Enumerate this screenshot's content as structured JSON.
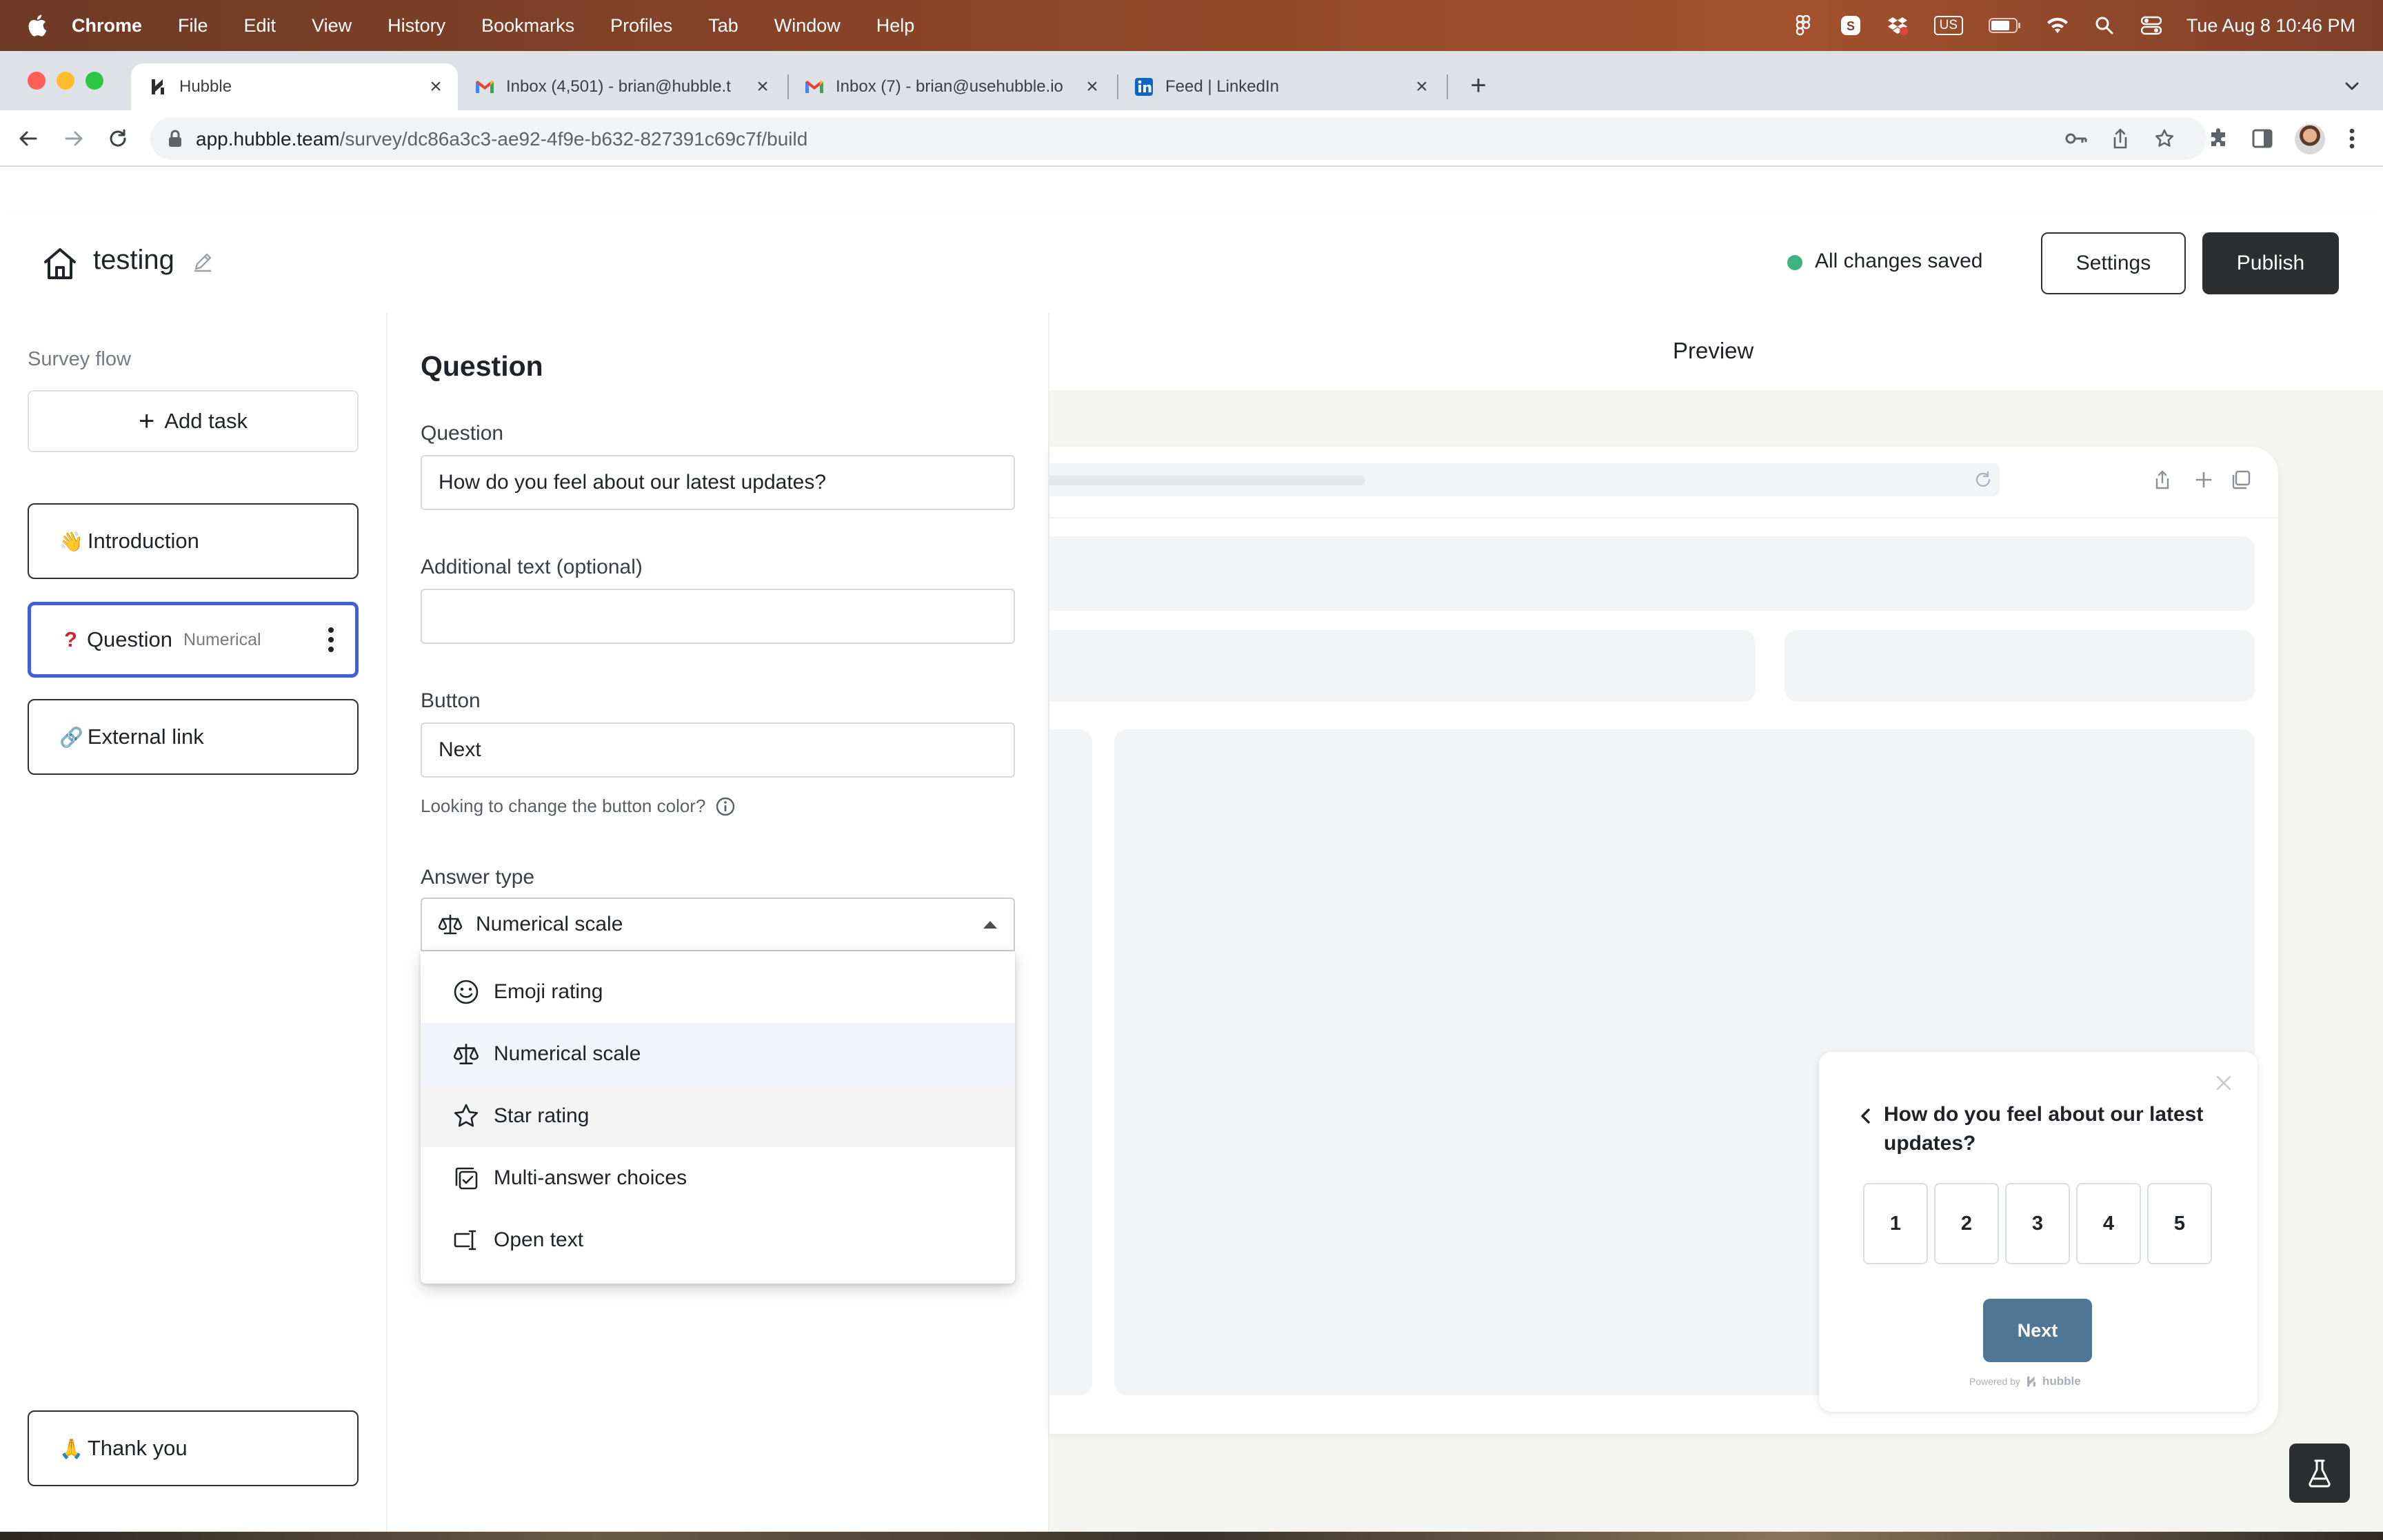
{
  "menubar": {
    "app_name": "Chrome",
    "items": [
      "File",
      "Edit",
      "View",
      "History",
      "Bookmarks",
      "Profiles",
      "Tab",
      "Window",
      "Help"
    ],
    "keyboard_label": "US",
    "clock": "Tue Aug 8  10:46 PM"
  },
  "browser": {
    "tabs": [
      {
        "title": "Hubble",
        "icon": "hubble-icon"
      },
      {
        "title": "Inbox (4,501) - brian@hubble.t",
        "icon": "gmail-icon"
      },
      {
        "title": "Inbox (7) - brian@usehubble.io",
        "icon": "gmail-icon"
      },
      {
        "title": "Feed | LinkedIn",
        "icon": "linkedin-icon"
      }
    ],
    "url_host": "app.hubble.team",
    "url_path": "/survey/dc86a3c3-ae92-4f9e-b632-827391c69c7f/build"
  },
  "header": {
    "survey_name": "testing",
    "save_status": "All changes saved",
    "settings_label": "Settings",
    "publish_label": "Publish",
    "status_color": "#3fb37f"
  },
  "sidebar": {
    "title": "Survey flow",
    "add_task_label": "Add task",
    "items": [
      {
        "emoji": "👋",
        "label": "Introduction"
      },
      {
        "emoji": "❓",
        "label": "Question",
        "sublabel": "Numerical"
      },
      {
        "emoji": "🔗",
        "label": "External link"
      }
    ],
    "thank_you": {
      "emoji": "🙏",
      "label": "Thank you"
    },
    "selected_border_color": "#3d5fdc"
  },
  "editor": {
    "title": "Question",
    "question_label": "Question",
    "question_value": "How do you feel about our latest updates?",
    "additional_label": "Additional text (optional)",
    "additional_value": "",
    "button_label": "Button",
    "button_value": "Next",
    "hint": "Looking to change the button color?",
    "answer_type_label": "Answer type",
    "answer_type_value": "Numerical scale",
    "answer_type_options": [
      {
        "label": "Emoji rating",
        "icon": "smiley-icon"
      },
      {
        "label": "Numerical scale",
        "icon": "scale-icon"
      },
      {
        "label": "Star rating",
        "icon": "star-icon"
      },
      {
        "label": "Multi-answer choices",
        "icon": "multi-check-icon"
      },
      {
        "label": "Open text",
        "icon": "text-cursor-icon"
      }
    ]
  },
  "preview": {
    "title": "Preview",
    "widget": {
      "question": "How do you feel about our latest updates?",
      "options": [
        "1",
        "2",
        "3",
        "4",
        "5"
      ],
      "next_label": "Next",
      "powered_by": "Powered by",
      "brand": "hubble",
      "button_color": "#4f7693"
    }
  }
}
